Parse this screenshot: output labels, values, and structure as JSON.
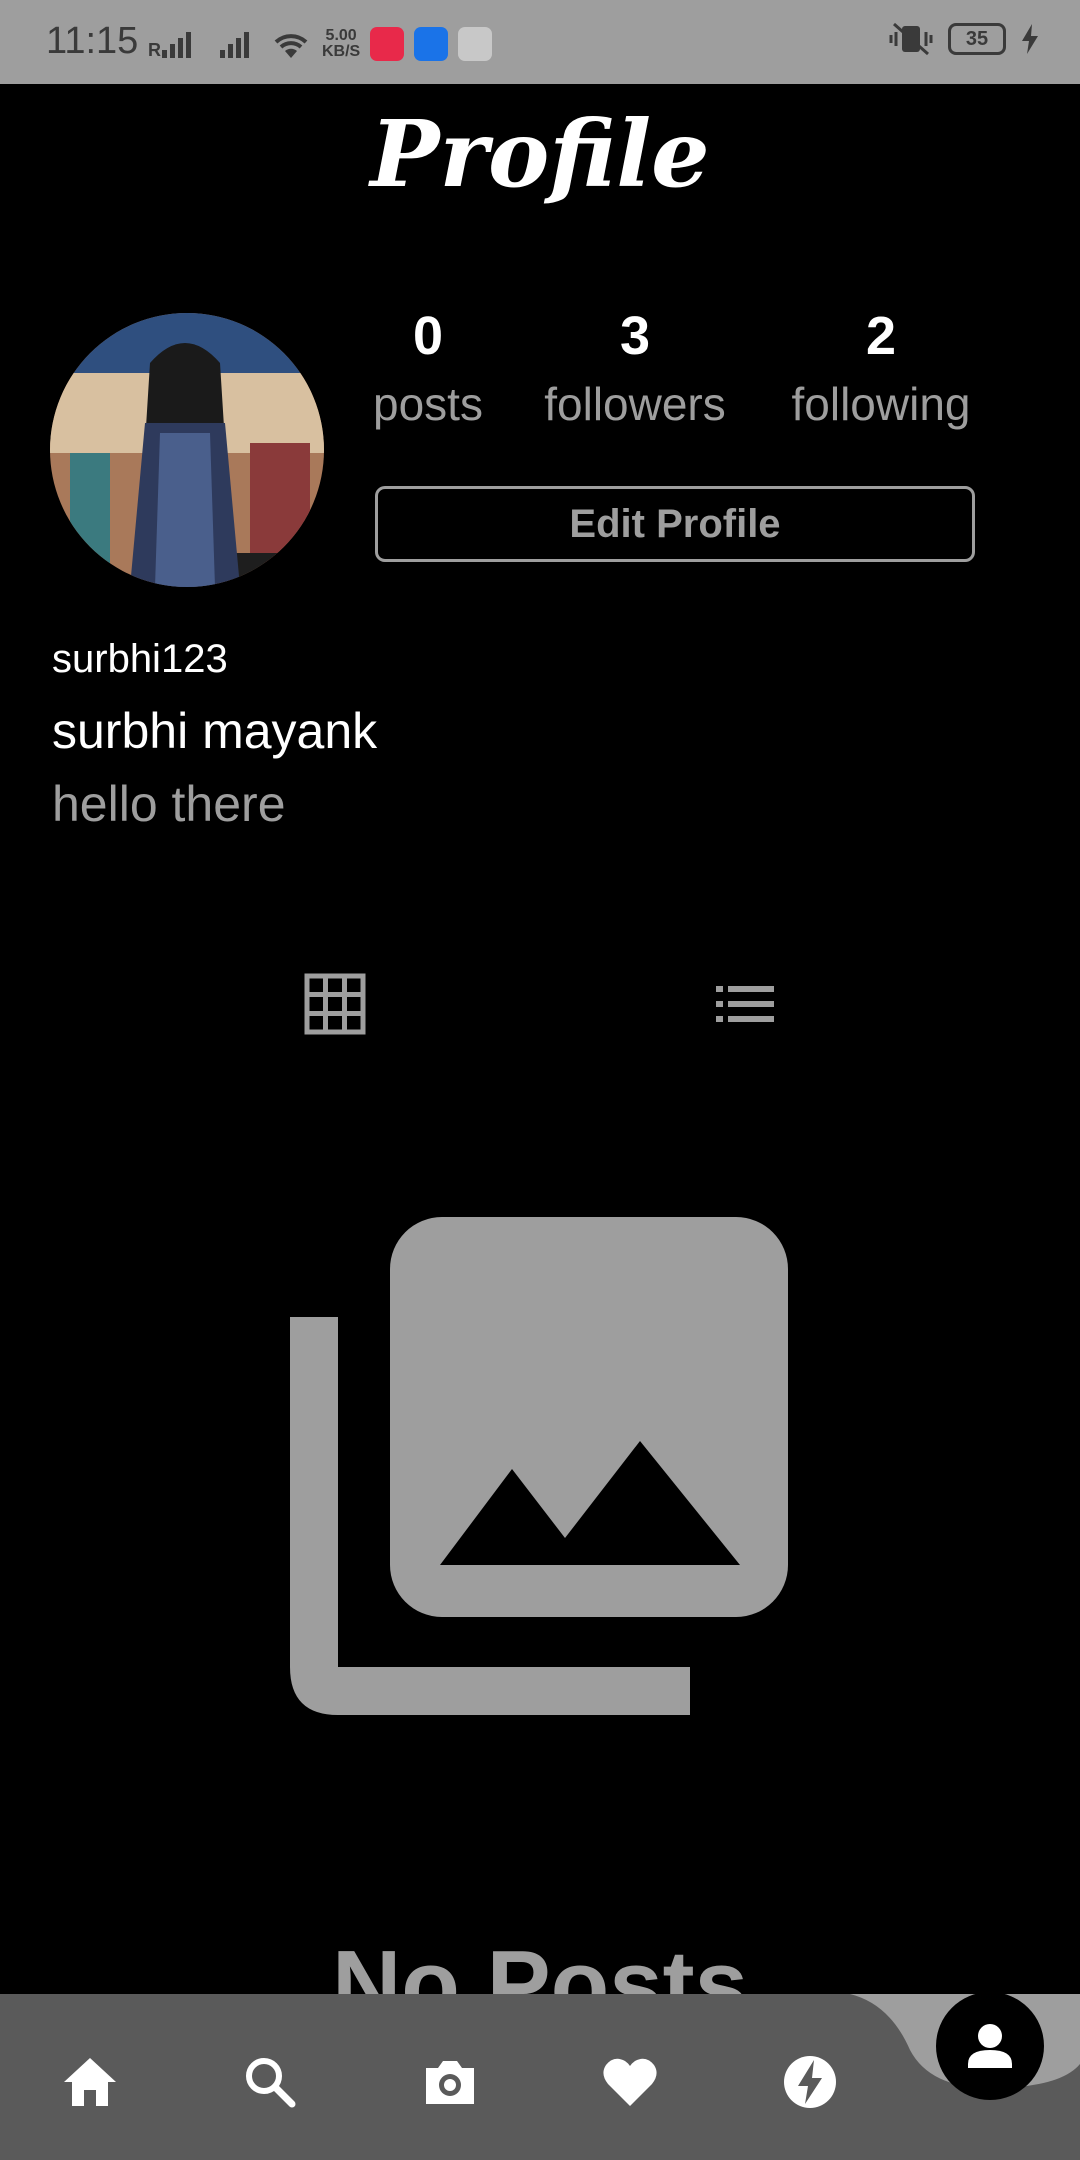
{
  "status_bar": {
    "time": "11:15",
    "network_speed": "5.00",
    "network_speed_unit": "KB/S",
    "battery": "35"
  },
  "header": {
    "title": "Profile"
  },
  "profile": {
    "stats": [
      {
        "value": "0",
        "label": "posts"
      },
      {
        "value": "3",
        "label": "followers"
      },
      {
        "value": "2",
        "label": "following"
      }
    ],
    "edit_button_label": "Edit Profile",
    "username": "surbhi123",
    "full_name": "surbhi mayank",
    "bio": "hello there"
  },
  "tabs": [
    {
      "icon": "grid-icon",
      "active": true
    },
    {
      "icon": "list-icon",
      "active": false
    }
  ],
  "empty_state": {
    "icon": "photo-library-icon",
    "text": "No Posts"
  },
  "bottom_nav": {
    "items": [
      "home-icon",
      "search-icon",
      "camera-icon",
      "heart-icon",
      "bolt-icon",
      "person-icon"
    ],
    "active": "person-icon"
  },
  "colors": {
    "background": "#000000",
    "muted": "#9e9e9e",
    "nav_bar": "#5a5a5a",
    "status_bar": "#9e9e9e"
  }
}
